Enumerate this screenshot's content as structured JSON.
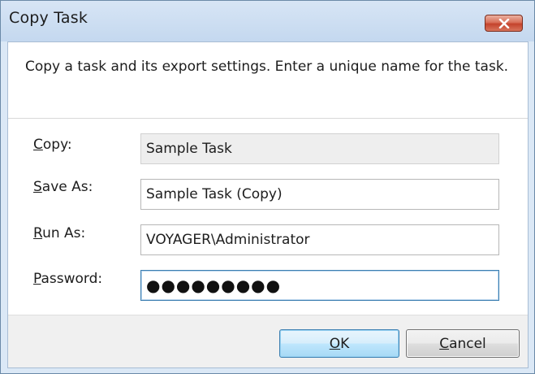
{
  "window": {
    "title": "Copy Task"
  },
  "description": "Copy a task and its export settings. Enter a unique name for the task.",
  "fields": [
    {
      "accel": "C",
      "rest": "opy:",
      "value": "Sample Task",
      "readonly": true
    },
    {
      "accel": "S",
      "rest": "ave As:",
      "value": "Sample Task (Copy)",
      "readonly": false
    },
    {
      "accel": "R",
      "rest": "un As:",
      "value": "VOYAGER\\Administrator",
      "readonly": false
    },
    {
      "accel": "P",
      "rest": "assword:",
      "value": "●●●●●●●●●",
      "masked": true
    }
  ],
  "buttons": {
    "ok": {
      "accel": "O",
      "rest": "K"
    },
    "cancel": {
      "accel": "C",
      "rest": "ancel"
    }
  },
  "colors": {
    "titlebar": "#c4d8ef",
    "close_button": "#c4432c",
    "ok_border": "#3c7fb1"
  },
  "icons": {
    "close": "close-icon"
  }
}
